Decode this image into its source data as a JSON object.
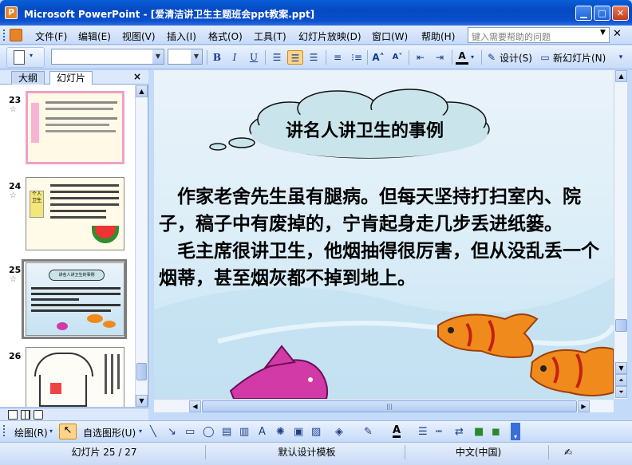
{
  "window": {
    "title": "Microsoft PowerPoint - [爱清洁讲卫生主题班会ppt教案.ppt]",
    "min_glyph": "▁",
    "max_glyph": "□",
    "close_glyph": "✕"
  },
  "menu": {
    "items": [
      "文件(F)",
      "编辑(E)",
      "视图(V)",
      "插入(I)",
      "格式(O)",
      "工具(T)",
      "幻灯片放映(D)",
      "窗口(W)",
      "帮助(H)"
    ],
    "help_placeholder": "键入需要帮助的问题",
    "close_glyph": "✕"
  },
  "toolbar": {
    "bold": "B",
    "italic": "I",
    "underline": "U",
    "design_label": "设计(S)",
    "new_slide_label": "新幻灯片(N)"
  },
  "panel": {
    "tab_outline": "大纲",
    "tab_slides": "幻灯片",
    "close_glyph": "×",
    "thumbnails": [
      {
        "number": "23",
        "star": "☆"
      },
      {
        "number": "24",
        "star": "☆"
      },
      {
        "number": "25",
        "star": "☆"
      },
      {
        "number": "26",
        "star": ""
      }
    ],
    "thumb24_sidelabel": "个人卫生",
    "thumb25_title": "讲名人讲卫生的事例"
  },
  "slide": {
    "title": "讲名人讲卫生的事例",
    "paragraph1": "　作家老舍先生虽有腿病。但每天坚持打扫室内、院子，稿子中有废掉的，宁肯起身走几步丢进纸篓。",
    "paragraph2": "　毛主席很讲卫生，他烟抽得很厉害，但从没乱丢一个烟蒂，甚至烟灰都不掉到地上。"
  },
  "drawing": {
    "draw_label": "绘图(R)",
    "autoshape_label": "自选图形(U)"
  },
  "status": {
    "slide_info": "幻灯片 25 / 27",
    "template": "默认设计模板",
    "language": "中文(中国)"
  },
  "colors": {
    "titlebar": "#0549c2",
    "fish_orange": "#f08a1c",
    "fish_pink": "#d23aa8"
  }
}
